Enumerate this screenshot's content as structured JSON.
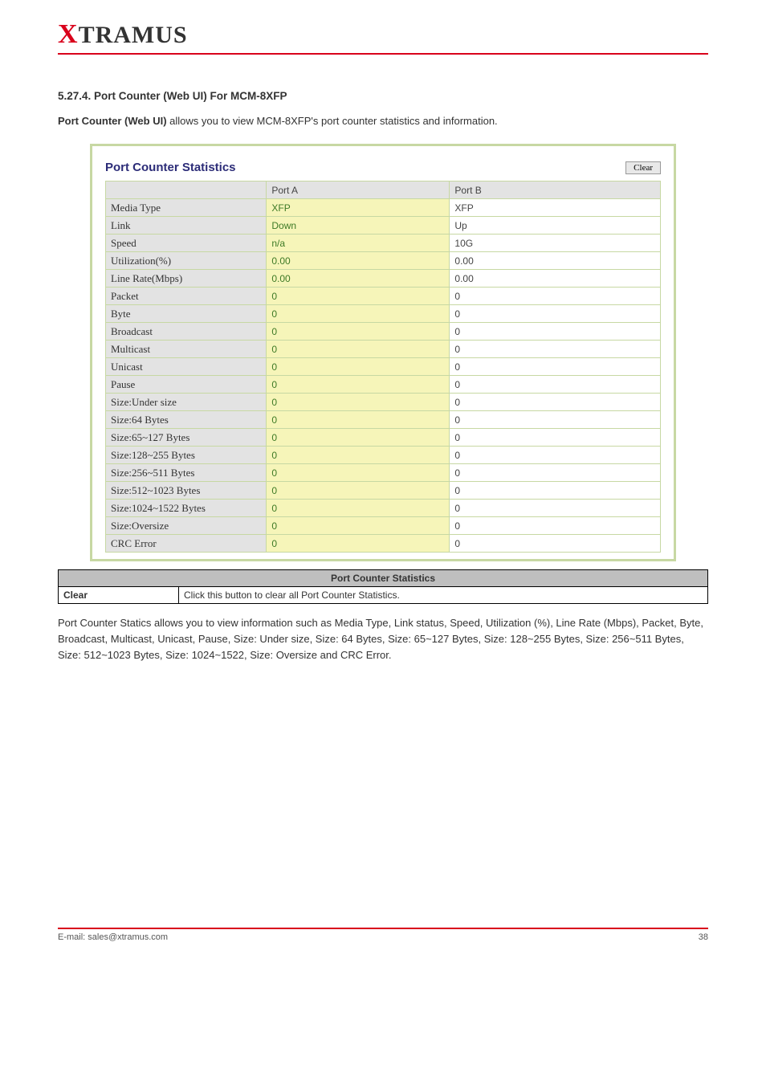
{
  "logo": {
    "part1": "X",
    "part2": "TRAMUS"
  },
  "section_title": "5.27.4. Port Counter (Web UI) For MCM-8XFP",
  "intro": {
    "before_bold": "",
    "bold": "Port Counter (Web UI)",
    "after_bold": " allows you to view MCM-8XFP's port counter statistics and information."
  },
  "screenshot": {
    "title": "Port Counter Statistics",
    "clear_label": "Clear",
    "headers": [
      "",
      "Port A",
      "Port B"
    ],
    "rows": [
      {
        "label": "Media Type",
        "a": "XFP",
        "b": "XFP"
      },
      {
        "label": "Link",
        "a": "Down",
        "b": "Up"
      },
      {
        "label": "Speed",
        "a": "n/a",
        "b": "10G"
      },
      {
        "label": "Utilization(%)",
        "a": "0.00",
        "b": "0.00"
      },
      {
        "label": "Line Rate(Mbps)",
        "a": "0.00",
        "b": "0.00"
      },
      {
        "label": "Packet",
        "a": "0",
        "b": "0"
      },
      {
        "label": "Byte",
        "a": "0",
        "b": "0"
      },
      {
        "label": "Broadcast",
        "a": "0",
        "b": "0"
      },
      {
        "label": "Multicast",
        "a": "0",
        "b": "0"
      },
      {
        "label": "Unicast",
        "a": "0",
        "b": "0"
      },
      {
        "label": "Pause",
        "a": "0",
        "b": "0"
      },
      {
        "label": "Size:Under size",
        "a": "0",
        "b": "0"
      },
      {
        "label": "Size:64 Bytes",
        "a": "0",
        "b": "0"
      },
      {
        "label": "Size:65~127 Bytes",
        "a": "0",
        "b": "0"
      },
      {
        "label": "Size:128~255 Bytes",
        "a": "0",
        "b": "0"
      },
      {
        "label": "Size:256~511 Bytes",
        "a": "0",
        "b": "0"
      },
      {
        "label": "Size:512~1023 Bytes",
        "a": "0",
        "b": "0"
      },
      {
        "label": "Size:1024~1522 Bytes",
        "a": "0",
        "b": "0"
      },
      {
        "label": "Size:Oversize",
        "a": "0",
        "b": "0"
      },
      {
        "label": "CRC Error",
        "a": "0",
        "b": "0"
      }
    ]
  },
  "desc_table": {
    "header": "Port Counter Statistics",
    "rows": [
      {
        "name": "Clear",
        "desc": "Click this button to clear all Port Counter Statistics."
      }
    ]
  },
  "body_para": "Port Counter Statics allows you to view information such as Media Type, Link status, Speed, Utilization (%), Line Rate (Mbps), Packet, Byte, Broadcast, Multicast, Unicast, Pause, Size: Under size, Size: 64 Bytes, Size: 65~127 Bytes, Size: 128~255 Bytes, Size: 256~511 Bytes, Size: 512~1023 Bytes, Size: 1024~1522, Size: Oversize and CRC Error.",
  "footer": {
    "left": "E-mail: sales@xtramus.com",
    "right": "38"
  }
}
